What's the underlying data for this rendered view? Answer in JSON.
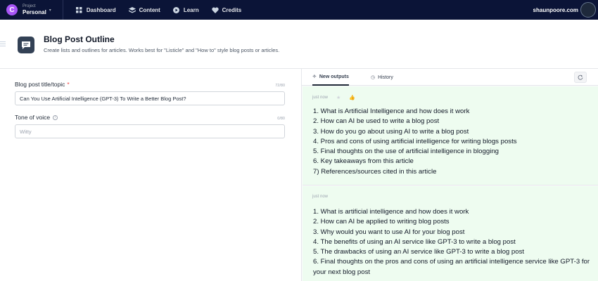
{
  "nav": {
    "logo_letter": "C",
    "project_label": "Project",
    "project_name": "Personal",
    "items": [
      {
        "label": "Dashboard",
        "icon": "grid-icon"
      },
      {
        "label": "Content",
        "icon": "stack-icon"
      },
      {
        "label": "Learn",
        "icon": "play-icon"
      },
      {
        "label": "Credits",
        "icon": "heart-icon"
      }
    ],
    "username": "shaunpoore.com"
  },
  "header": {
    "title": "Blog Post Outline",
    "subtitle": "Create lists and outlines for articles. Works best for \"Listicle\" and \"How to\" style blog posts or articles."
  },
  "form": {
    "topic": {
      "label": "Blog post title/topic",
      "required_mark": "*",
      "counter": "72/80",
      "value": "Can You Use Artificial Intelligence (GPT-3) To Write a Better Blog Post?"
    },
    "tone": {
      "label": "Tone of voice",
      "counter": "0/80",
      "placeholder": "Witty"
    }
  },
  "outputs_panel": {
    "tabs": [
      {
        "label": "New outputs",
        "active": true
      },
      {
        "label": "History",
        "active": false
      }
    ],
    "outputs": [
      {
        "timestamp": "just now",
        "lines": [
          "1. What is Artificial Intelligence and how does it work",
          "2. How can AI be used to write a blog post",
          "3. How do you go about using AI to write a blog post",
          "4. Pros and cons of using artificial intelligence for writing blogs posts",
          "5. Final thoughts on the use of artificial intelligence in blogging",
          "6. Key takeaways from this article",
          "7) References/sources cited in this article"
        ]
      },
      {
        "timestamp": "just now",
        "lines": [
          "1. What is artificial intelligence and how does it work",
          "2. How can AI be applied to writing blog posts",
          "3. Why would you want to use AI for your blog post",
          "4. The benefits of using an AI service like GPT-3 to write a blog post",
          "5. The drawbacks of using an AI service like GPT-3 to write a blog post",
          "6. Final thoughts on the pros and cons of using an artificial intelligence service like GPT-3 for your next blog post"
        ]
      }
    ]
  },
  "colors": {
    "nav_bg": "#0b1437",
    "logo": "#a855f7",
    "output_bg": "#eefcf0",
    "required": "#ef4444"
  }
}
